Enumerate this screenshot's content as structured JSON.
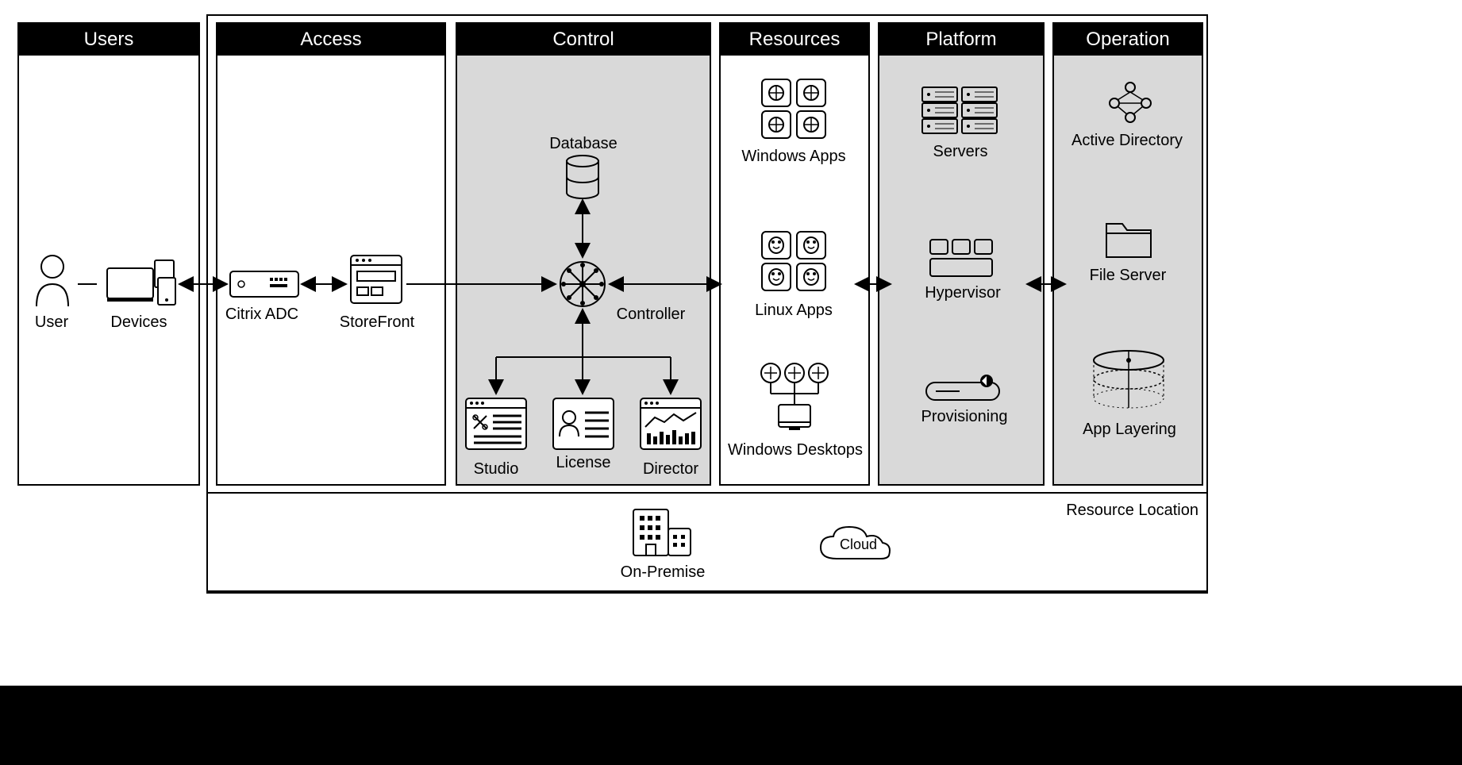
{
  "sections": {
    "users": {
      "title": "Users",
      "items": {
        "user": "User",
        "devices": "Devices"
      }
    },
    "access": {
      "title": "Access",
      "items": {
        "citrix_adc": "Citrix ADC",
        "storefront": "StoreFront"
      }
    },
    "control": {
      "title": "Control",
      "items": {
        "database": "Database",
        "controller": "Controller",
        "studio": "Studio",
        "license": "License",
        "director": "Director"
      }
    },
    "resources": {
      "title": "Resources",
      "items": {
        "windows_apps": "Windows Apps",
        "linux_apps": "Linux Apps",
        "windows_desktops": "Windows Desktops"
      }
    },
    "platform": {
      "title": "Platform",
      "items": {
        "servers": "Servers",
        "hypervisor": "Hypervisor",
        "provisioning": "Provisioning"
      }
    },
    "operation": {
      "title": "Operation",
      "items": {
        "active_directory": "Active Directory",
        "file_server": "File Server",
        "app_layering": "App Layering"
      }
    }
  },
  "footer": {
    "resource_location": "Resource Location",
    "on_premise": "On-Premise",
    "cloud": "Cloud"
  }
}
